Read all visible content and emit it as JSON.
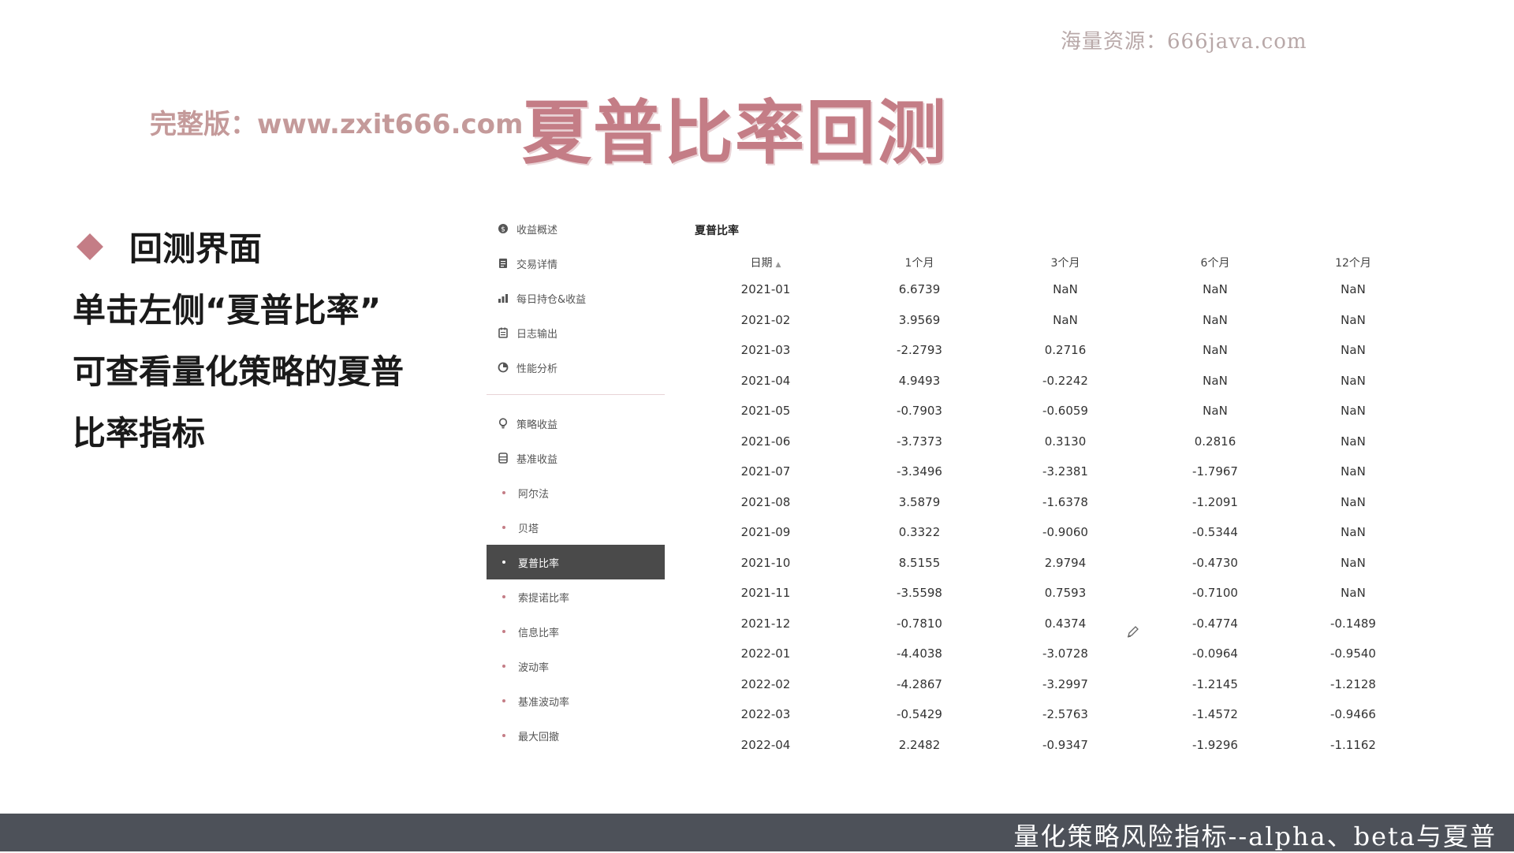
{
  "watermark_top": "海量资源：666java.com",
  "site_link": "完整版：www.zxit666.com",
  "slide_title": "夏普比率回测",
  "bullet": {
    "label": "回测界面",
    "lines": [
      "单击左侧“夏普比率”",
      "可查看量化策略的夏普",
      "比率指标"
    ]
  },
  "sidebar": {
    "group1": [
      {
        "label": "收益概述",
        "icon": "dollar-icon"
      },
      {
        "label": "交易详情",
        "icon": "document-icon"
      },
      {
        "label": "每日持仓&收益",
        "icon": "bar-chart-icon"
      },
      {
        "label": "日志输出",
        "icon": "log-icon"
      },
      {
        "label": "性能分析",
        "icon": "pie-icon"
      }
    ],
    "group2": [
      {
        "label": "策略收益",
        "icon": "bulb-icon"
      },
      {
        "label": "基准收益",
        "icon": "database-icon"
      },
      {
        "label": "阿尔法"
      },
      {
        "label": "贝塔"
      },
      {
        "label": "夏普比率",
        "active": true
      },
      {
        "label": "索提诺比率"
      },
      {
        "label": "信息比率"
      },
      {
        "label": "波动率"
      },
      {
        "label": "基准波动率"
      },
      {
        "label": "最大回撤"
      }
    ]
  },
  "table": {
    "title": "夏普比率",
    "headers": [
      "日期",
      "1个月",
      "3个月",
      "6个月",
      "12个月"
    ],
    "sort_indicator": "▲",
    "rows": [
      [
        "2021-01",
        "6.6739",
        "NaN",
        "NaN",
        "NaN"
      ],
      [
        "2021-02",
        "3.9569",
        "NaN",
        "NaN",
        "NaN"
      ],
      [
        "2021-03",
        "-2.2793",
        "0.2716",
        "NaN",
        "NaN"
      ],
      [
        "2021-04",
        "4.9493",
        "-0.2242",
        "NaN",
        "NaN"
      ],
      [
        "2021-05",
        "-0.7903",
        "-0.6059",
        "NaN",
        "NaN"
      ],
      [
        "2021-06",
        "-3.7373",
        "0.3130",
        "0.2816",
        "NaN"
      ],
      [
        "2021-07",
        "-3.3496",
        "-3.2381",
        "-1.7967",
        "NaN"
      ],
      [
        "2021-08",
        "3.5879",
        "-1.6378",
        "-1.2091",
        "NaN"
      ],
      [
        "2021-09",
        "0.3322",
        "-0.9060",
        "-0.5344",
        "NaN"
      ],
      [
        "2021-10",
        "8.5155",
        "2.9794",
        "-0.4730",
        "NaN"
      ],
      [
        "2021-11",
        "-3.5598",
        "0.7593",
        "-0.7100",
        "NaN"
      ],
      [
        "2021-12",
        "-0.7810",
        "0.4374",
        "-0.4774",
        "-0.1489"
      ],
      [
        "2022-01",
        "-4.4038",
        "-3.0728",
        "-0.0964",
        "-0.9540"
      ],
      [
        "2022-02",
        "-4.2867",
        "-3.2997",
        "-1.2145",
        "-1.2128"
      ],
      [
        "2022-03",
        "-0.5429",
        "-2.5763",
        "-1.4572",
        "-0.9466"
      ],
      [
        "2022-04",
        "2.2482",
        "-0.9347",
        "-1.9296",
        "-1.1162"
      ]
    ]
  },
  "bottom_caption": "量化策略风险指标--alpha、beta与夏普",
  "colors": {
    "accent": "#c47d86",
    "active_menu_bg": "#4a4a4a",
    "bottom_bar": "#4d5159"
  }
}
